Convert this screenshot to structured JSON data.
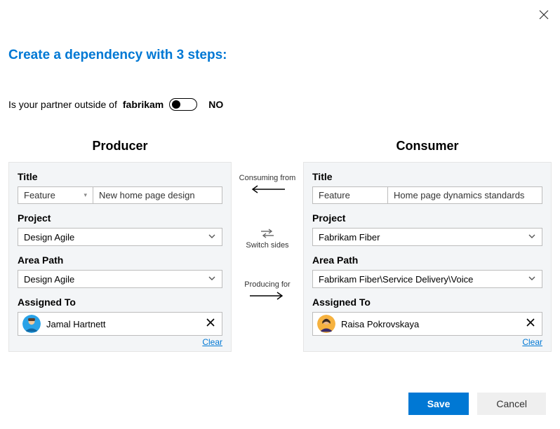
{
  "header": "Create a dependency with 3 steps:",
  "partnerQuestion": {
    "prefix": "Is your partner outside of ",
    "org": "fabrikam",
    "state_label": "NO"
  },
  "middle": {
    "consuming": "Consuming from",
    "switch": "Switch sides",
    "producing": "Producing for"
  },
  "producer": {
    "heading": "Producer",
    "labels": {
      "title": "Title",
      "project": "Project",
      "area": "Area Path",
      "assigned": "Assigned To"
    },
    "type": "Feature",
    "title": "New home page design",
    "project": "Design Agile",
    "area": "Design Agile",
    "assigned": "Jamal Hartnett",
    "clear": "Clear"
  },
  "consumer": {
    "heading": "Consumer",
    "labels": {
      "title": "Title",
      "project": "Project",
      "area": "Area Path",
      "assigned": "Assigned To"
    },
    "type": "Feature",
    "title": "Home page dynamics standards",
    "project": "Fabrikam Fiber",
    "area": "Fabrikam Fiber\\Service Delivery\\Voice",
    "assigned": "Raisa Pokrovskaya",
    "clear": "Clear"
  },
  "footer": {
    "save": "Save",
    "cancel": "Cancel"
  }
}
